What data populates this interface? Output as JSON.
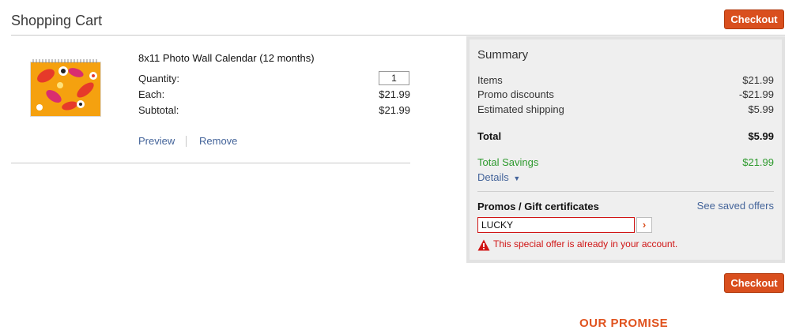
{
  "header": {
    "title": "Shopping Cart",
    "checkout_label": "Checkout"
  },
  "cart": {
    "item": {
      "name": "8x11 Photo Wall Calendar (12 months)",
      "quantity_label": "Quantity:",
      "quantity_value": "1",
      "each_label": "Each:",
      "each_value": "$21.99",
      "subtotal_label": "Subtotal:",
      "subtotal_value": "$21.99",
      "preview_label": "Preview",
      "remove_label": "Remove"
    }
  },
  "summary": {
    "title": "Summary",
    "items_label": "Items",
    "items_value": "$21.99",
    "promo_label": "Promo discounts",
    "promo_value": "-$21.99",
    "shipping_label": "Estimated shipping",
    "shipping_value": "$5.99",
    "total_label": "Total",
    "total_value": "$5.99",
    "savings_label": "Total Savings",
    "savings_value": "$21.99",
    "details_label": "Details",
    "promos_heading": "Promos / Gift certificates",
    "saved_offers_label": "See saved offers",
    "promo_code_value": "LUCKY",
    "error_message": "This special offer is already in your account."
  },
  "footer": {
    "checkout_label": "Checkout",
    "promise_heading": "OUR PROMISE"
  },
  "colors": {
    "accent": "#d94f1e",
    "link": "#44649a",
    "error": "#d01515",
    "savings": "#2e9a2e"
  }
}
